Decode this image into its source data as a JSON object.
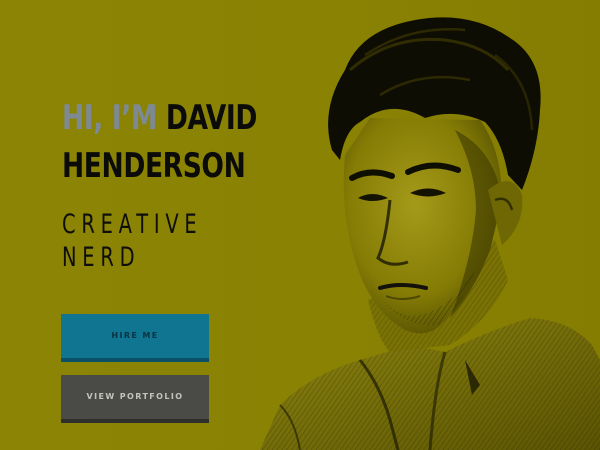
{
  "hero": {
    "greeting": "HI, I’M",
    "name_first": "DAVID",
    "name_last": "HENDERSON",
    "subtitle_line1": "CREATIVE",
    "subtitle_line2": "NERD"
  },
  "actions": {
    "hire_label": "HIRE ME",
    "portfolio_label": "VIEW PORTFOLIO"
  },
  "colors": {
    "background": "#8a8203",
    "greeting_text": "#7d8a93",
    "primary_button": "#0f7590",
    "secondary_button": "#4a4a47"
  }
}
